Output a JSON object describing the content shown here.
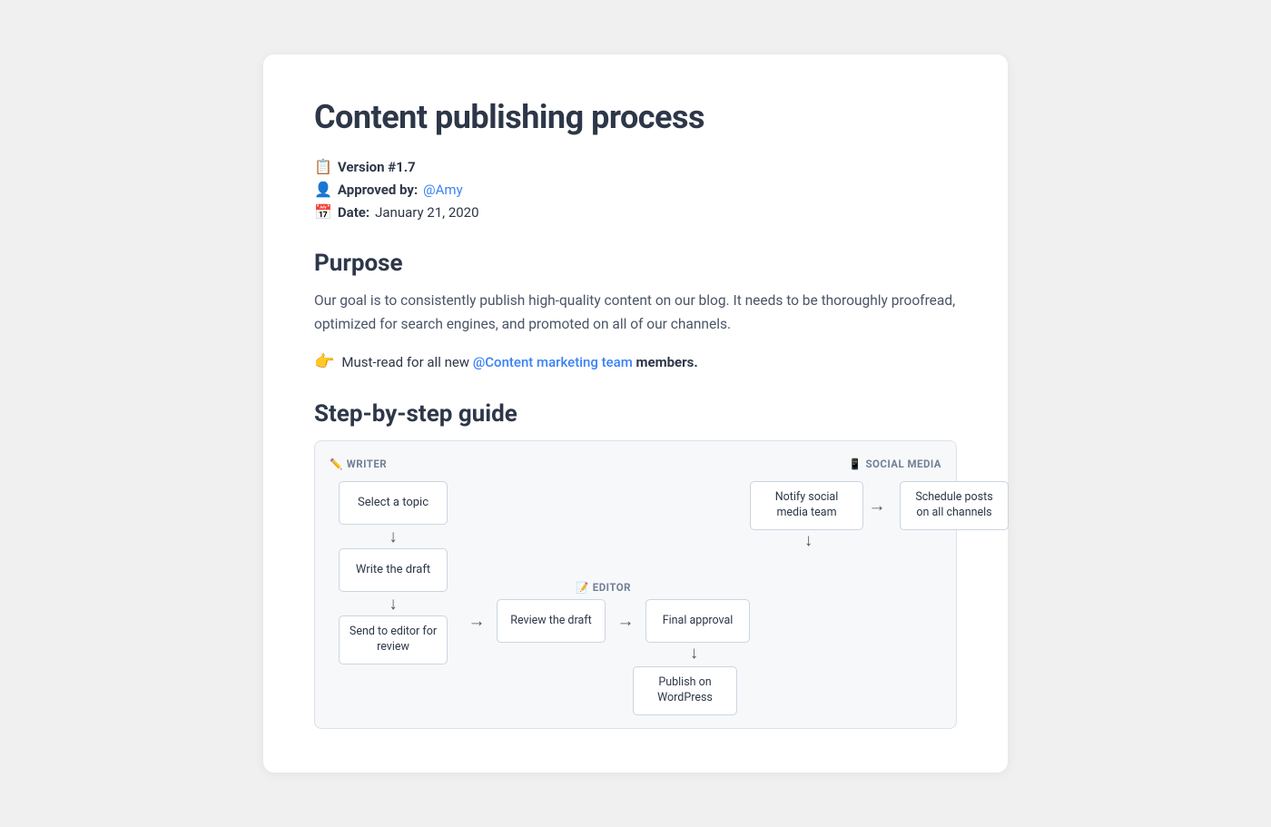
{
  "page": {
    "title": "Content publishing process",
    "meta": {
      "version_icon": "📋",
      "version_label": "Version #1.7",
      "approved_icon": "👤",
      "approved_label": "Approved by:",
      "approved_link": "@Amy",
      "date_icon": "📅",
      "date_label": "Date:",
      "date_value": "January 21, 2020"
    },
    "purpose": {
      "title": "Purpose",
      "body": "Our goal is to consistently publish high-quality content on our blog. It needs to be thoroughly proofread, optimized for search engines, and promoted on all of our channels.",
      "callout_emoji": "👉",
      "callout_text": "Must-read for all new",
      "callout_link": "@Content marketing team",
      "callout_suffix": "members."
    },
    "guide": {
      "title": "Step-by-step guide",
      "diagram": {
        "writer_label_emoji": "✏️",
        "writer_label": "WRITER",
        "social_label_emoji": "📱",
        "social_label": "SOCIAL MEDIA",
        "editor_label_emoji": "📝",
        "editor_label": "EDITOR",
        "nodes": {
          "select_topic": "Select a topic",
          "write_draft": "Write the draft",
          "send_to_editor": "Send to editor for review",
          "review_draft": "Review the draft",
          "final_approval": "Final approval",
          "publish_wordpress": "Publish on WordPress",
          "notify_social": "Notify social media team",
          "schedule_posts": "Schedule posts on all channels"
        },
        "arrows": {
          "right": "→",
          "down": "↓",
          "up": "↑"
        }
      }
    }
  }
}
